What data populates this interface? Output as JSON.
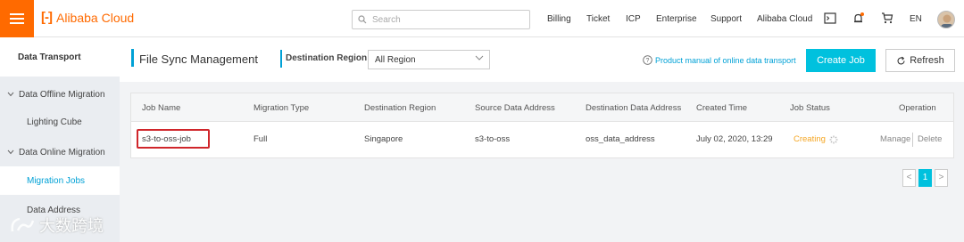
{
  "topbar": {
    "brand": "Alibaba Cloud",
    "search_placeholder": "Search",
    "nav": [
      "Billing",
      "Ticket",
      "ICP",
      "Enterprise",
      "Support",
      "Alibaba Cloud"
    ],
    "language": "EN",
    "accent_color": "#ff6a00"
  },
  "sidebar": {
    "title": "Data Transport",
    "items": [
      {
        "label": "Data Offline Migration",
        "type": "group"
      },
      {
        "label": "Lighting Cube",
        "type": "child"
      },
      {
        "label": "Data Online Migration",
        "type": "group"
      },
      {
        "label": "Migration Jobs",
        "type": "child",
        "active": true
      },
      {
        "label": "Data Address",
        "type": "child"
      }
    ]
  },
  "header": {
    "title": "File Sync Management",
    "region_label": "Destination Region:",
    "region_value": "All Region",
    "help_link": "Product manual of online data transport",
    "create_button": "Create Job",
    "refresh_button": "Refresh"
  },
  "table": {
    "columns": [
      "Job Name",
      "Migration Type",
      "Destination Region",
      "Source Data Address",
      "Destination Data Address",
      "Created Time",
      "Job Status",
      "Operation"
    ],
    "rows": [
      {
        "job_name": "s3-to-oss-job",
        "migration_type": "Full",
        "destination_region": "Singapore",
        "source_address": "s3-to-oss",
        "destination_address": "oss_data_address",
        "created_time": "July 02, 2020, 13:29",
        "status": "Creating",
        "op_manage": "Manage",
        "op_delete": "Delete"
      }
    ]
  },
  "pagination": {
    "prev": "<",
    "current": "1",
    "next": ">"
  },
  "watermark": "大数跨境",
  "colors": {
    "link": "#00a1d6",
    "primary_button": "#00c1de",
    "status_creating": "#f5a623",
    "highlight_box": "#d0262b"
  }
}
